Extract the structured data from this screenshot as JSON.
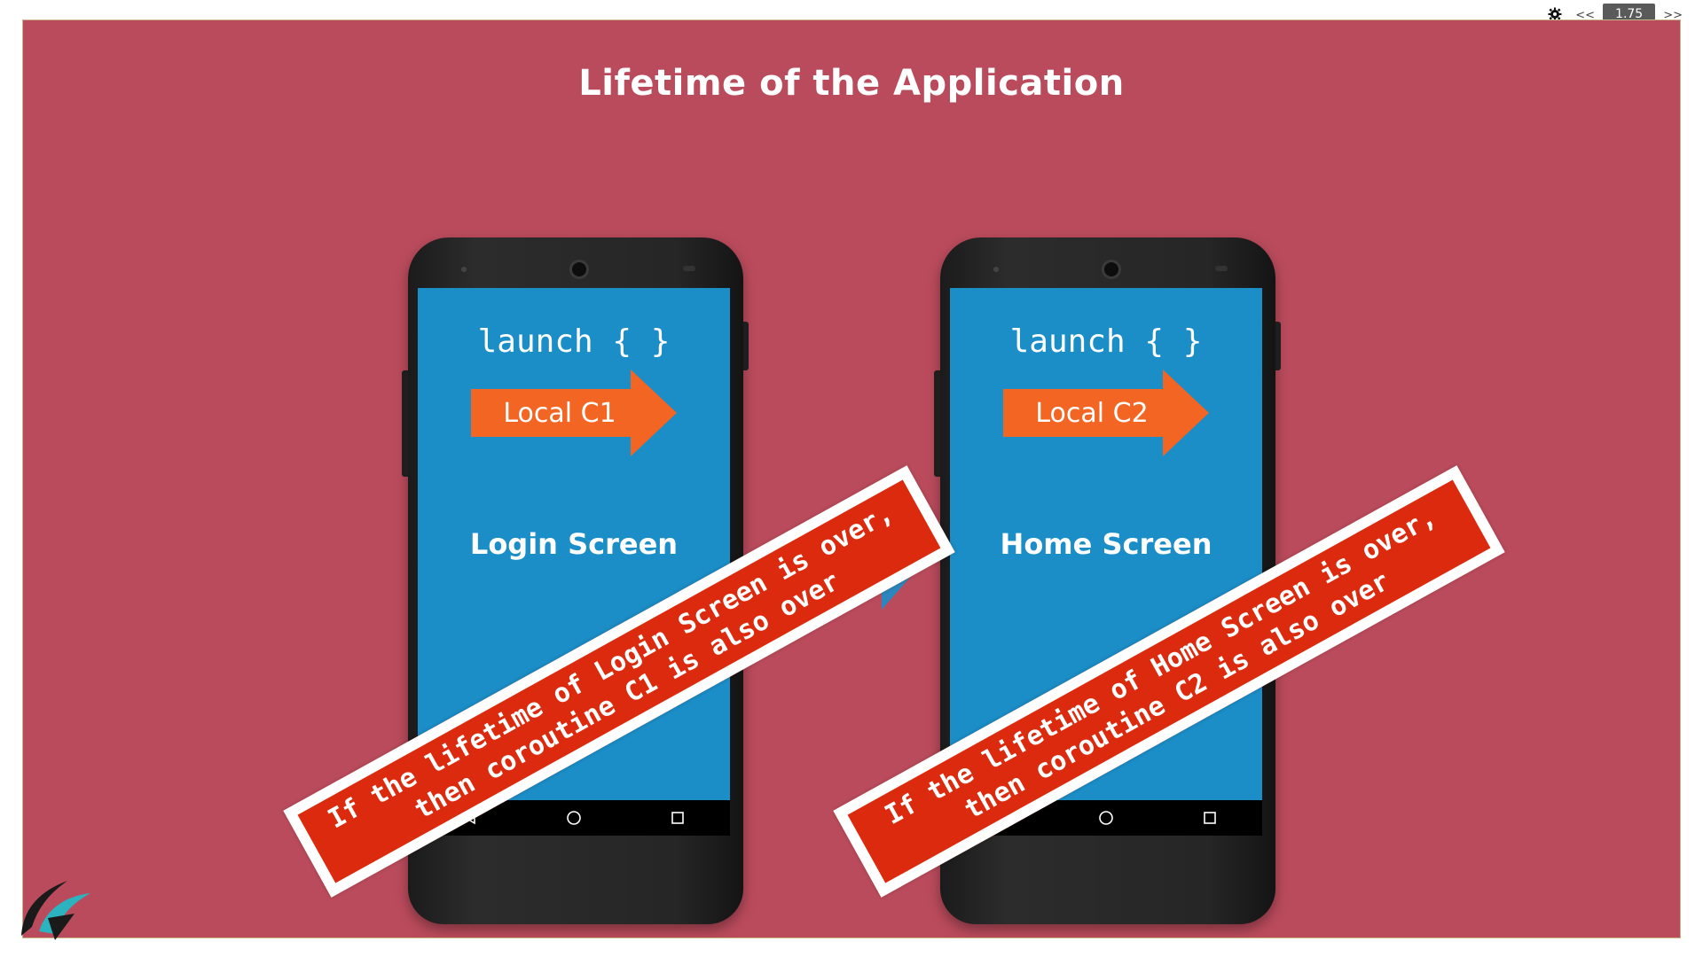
{
  "player": {
    "speed": "1.75",
    "back_label": "<<",
    "forward_label": ">>",
    "settings_icon": "gear-icon"
  },
  "slide": {
    "title": "Lifetime of the Application",
    "background": "#ba4b5c"
  },
  "phones": [
    {
      "code": "launch { }",
      "scope_label": "Local C1",
      "screen_name": "Login Screen",
      "banner": {
        "line1": "If the lifetime of Login Screen is over,",
        "line2": "then coroutine C1 is also over"
      }
    },
    {
      "code": "launch { }",
      "scope_label": "Local C2",
      "screen_name": "Home Screen",
      "banner": {
        "line1": "If the lifetime of Home Screen is over,",
        "line2": "then coroutine C2 is also over"
      }
    }
  ],
  "colors": {
    "screen": "#1b8dc7",
    "arrow": "#f26522",
    "banner": "#dc2a0e"
  }
}
